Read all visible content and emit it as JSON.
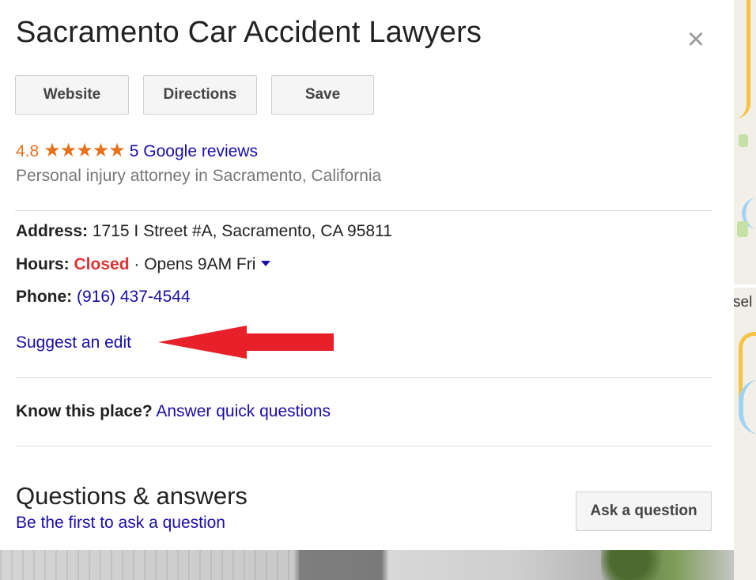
{
  "place": {
    "title": "Sacramento Car Accident Lawyers",
    "close_icon": "×",
    "buttons": {
      "website": "Website",
      "directions": "Directions",
      "save": "Save"
    },
    "rating": "4.8",
    "stars": "★★★★★",
    "stars_count": 5,
    "reviews_link": "5 Google reviews",
    "category": "Personal injury attorney in Sacramento, California"
  },
  "details": {
    "address_label": "Address:",
    "address_value": "1715 I Street #A, Sacramento, CA 95811",
    "hours_label": "Hours:",
    "hours_status": "Closed",
    "hours_next": " · Opens 9AM Fri",
    "phone_label": "Phone:",
    "phone_value": "(916) 437-4544",
    "suggest_edit": "Suggest an edit"
  },
  "know_place": {
    "label": "Know this place?",
    "link": "Answer quick questions"
  },
  "qa": {
    "title": "Questions & answers",
    "subtitle": "Be the first to ask a question",
    "ask_button": "Ask a question"
  },
  "map": {
    "partial_label": "sel"
  },
  "colors": {
    "link": "#1a0dab",
    "rating": "#e7711b",
    "closed": "#dd3333",
    "annotation_arrow": "#e8202a"
  },
  "icons": {
    "close": "close-icon",
    "star": "star-icon",
    "caret": "caret-down-icon",
    "arrow": "red-arrow-annotation"
  }
}
